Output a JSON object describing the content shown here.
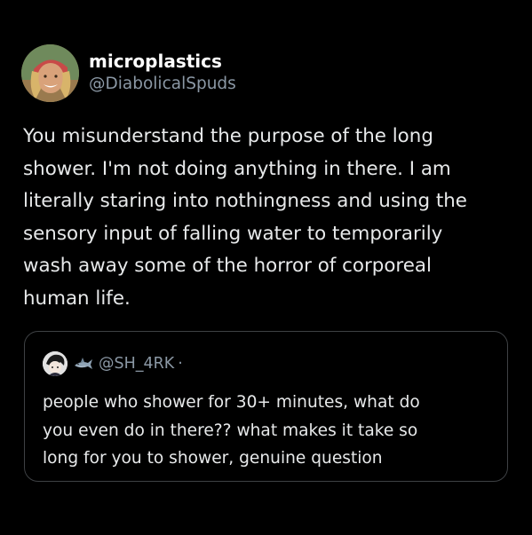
{
  "tweet": {
    "author": {
      "display_name": "microplastics",
      "handle": "@DiabolicalSpuds",
      "avatar": "profile-photo"
    },
    "text": "You misunderstand the purpose of the long\nshower. I'm not doing anything in there. I am\nliterally staring into nothingness and using the\nsensory input of falling water to temporarily\nwash away some of the horror of corporeal\nhuman life."
  },
  "quoted_tweet": {
    "author": {
      "handle": "@SH_4RK",
      "separator": "·",
      "avatar": "profile-photo",
      "emoji": "shark-emoji"
    },
    "text": "people who shower for 30+ minutes, what do\nyou even do in there?? what makes it take so\nlong for you to shower, genuine question"
  },
  "colors": {
    "background": "#000000",
    "primary_text": "#e7e9ea",
    "secondary_text": "#8b98a5",
    "border": "#3e4144"
  }
}
